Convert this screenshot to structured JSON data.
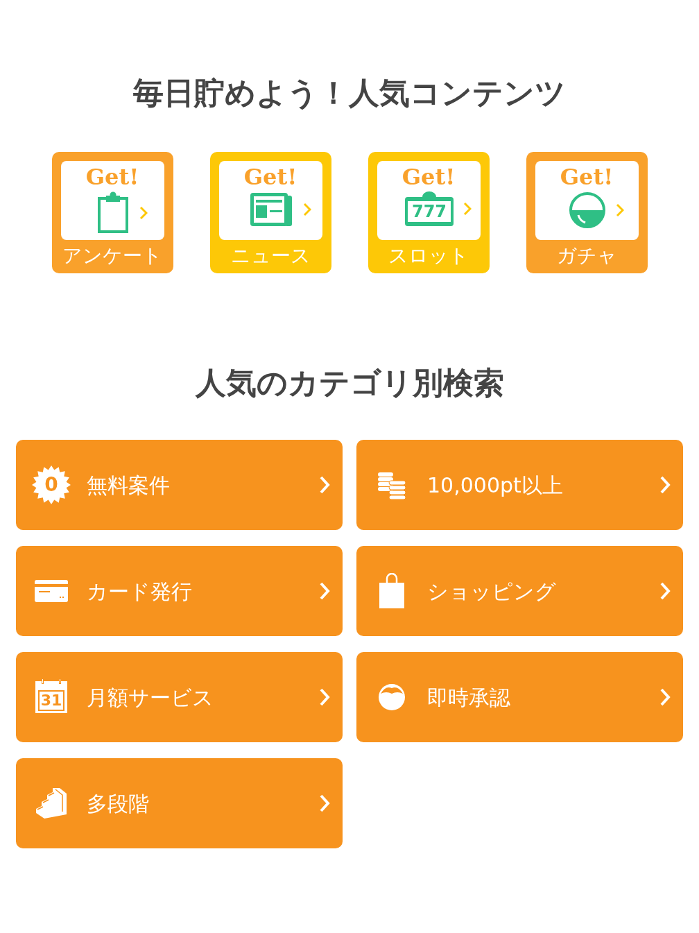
{
  "popular": {
    "title": "毎日貯めよう！人気コンテンツ",
    "tiles": [
      {
        "kind": "survey",
        "badge": "Get!",
        "label": "アンケート",
        "color": "#f9a12b"
      },
      {
        "kind": "news",
        "badge": "Get!",
        "label": "ニュース",
        "color": "#fdc807"
      },
      {
        "kind": "slot",
        "badge": "Get!",
        "icon_text": "777",
        "label": "スロット",
        "color": "#fdc807"
      },
      {
        "kind": "gacha",
        "badge": "Get!",
        "label": "ガチャ",
        "color": "#f9a12b"
      }
    ]
  },
  "categories": {
    "title": "人気のカテゴリ別検索",
    "items": [
      {
        "kind": "free",
        "icon_text": "0",
        "label": "無料案件"
      },
      {
        "kind": "points",
        "label": "10,000pt以上"
      },
      {
        "kind": "card",
        "label": "カード発行"
      },
      {
        "kind": "shopping",
        "label": "ショッピング"
      },
      {
        "kind": "monthly",
        "icon_text": "31",
        "label": "月額サービス"
      },
      {
        "kind": "instant",
        "label": "即時承認"
      },
      {
        "kind": "multistep",
        "label": "多段階"
      }
    ]
  }
}
